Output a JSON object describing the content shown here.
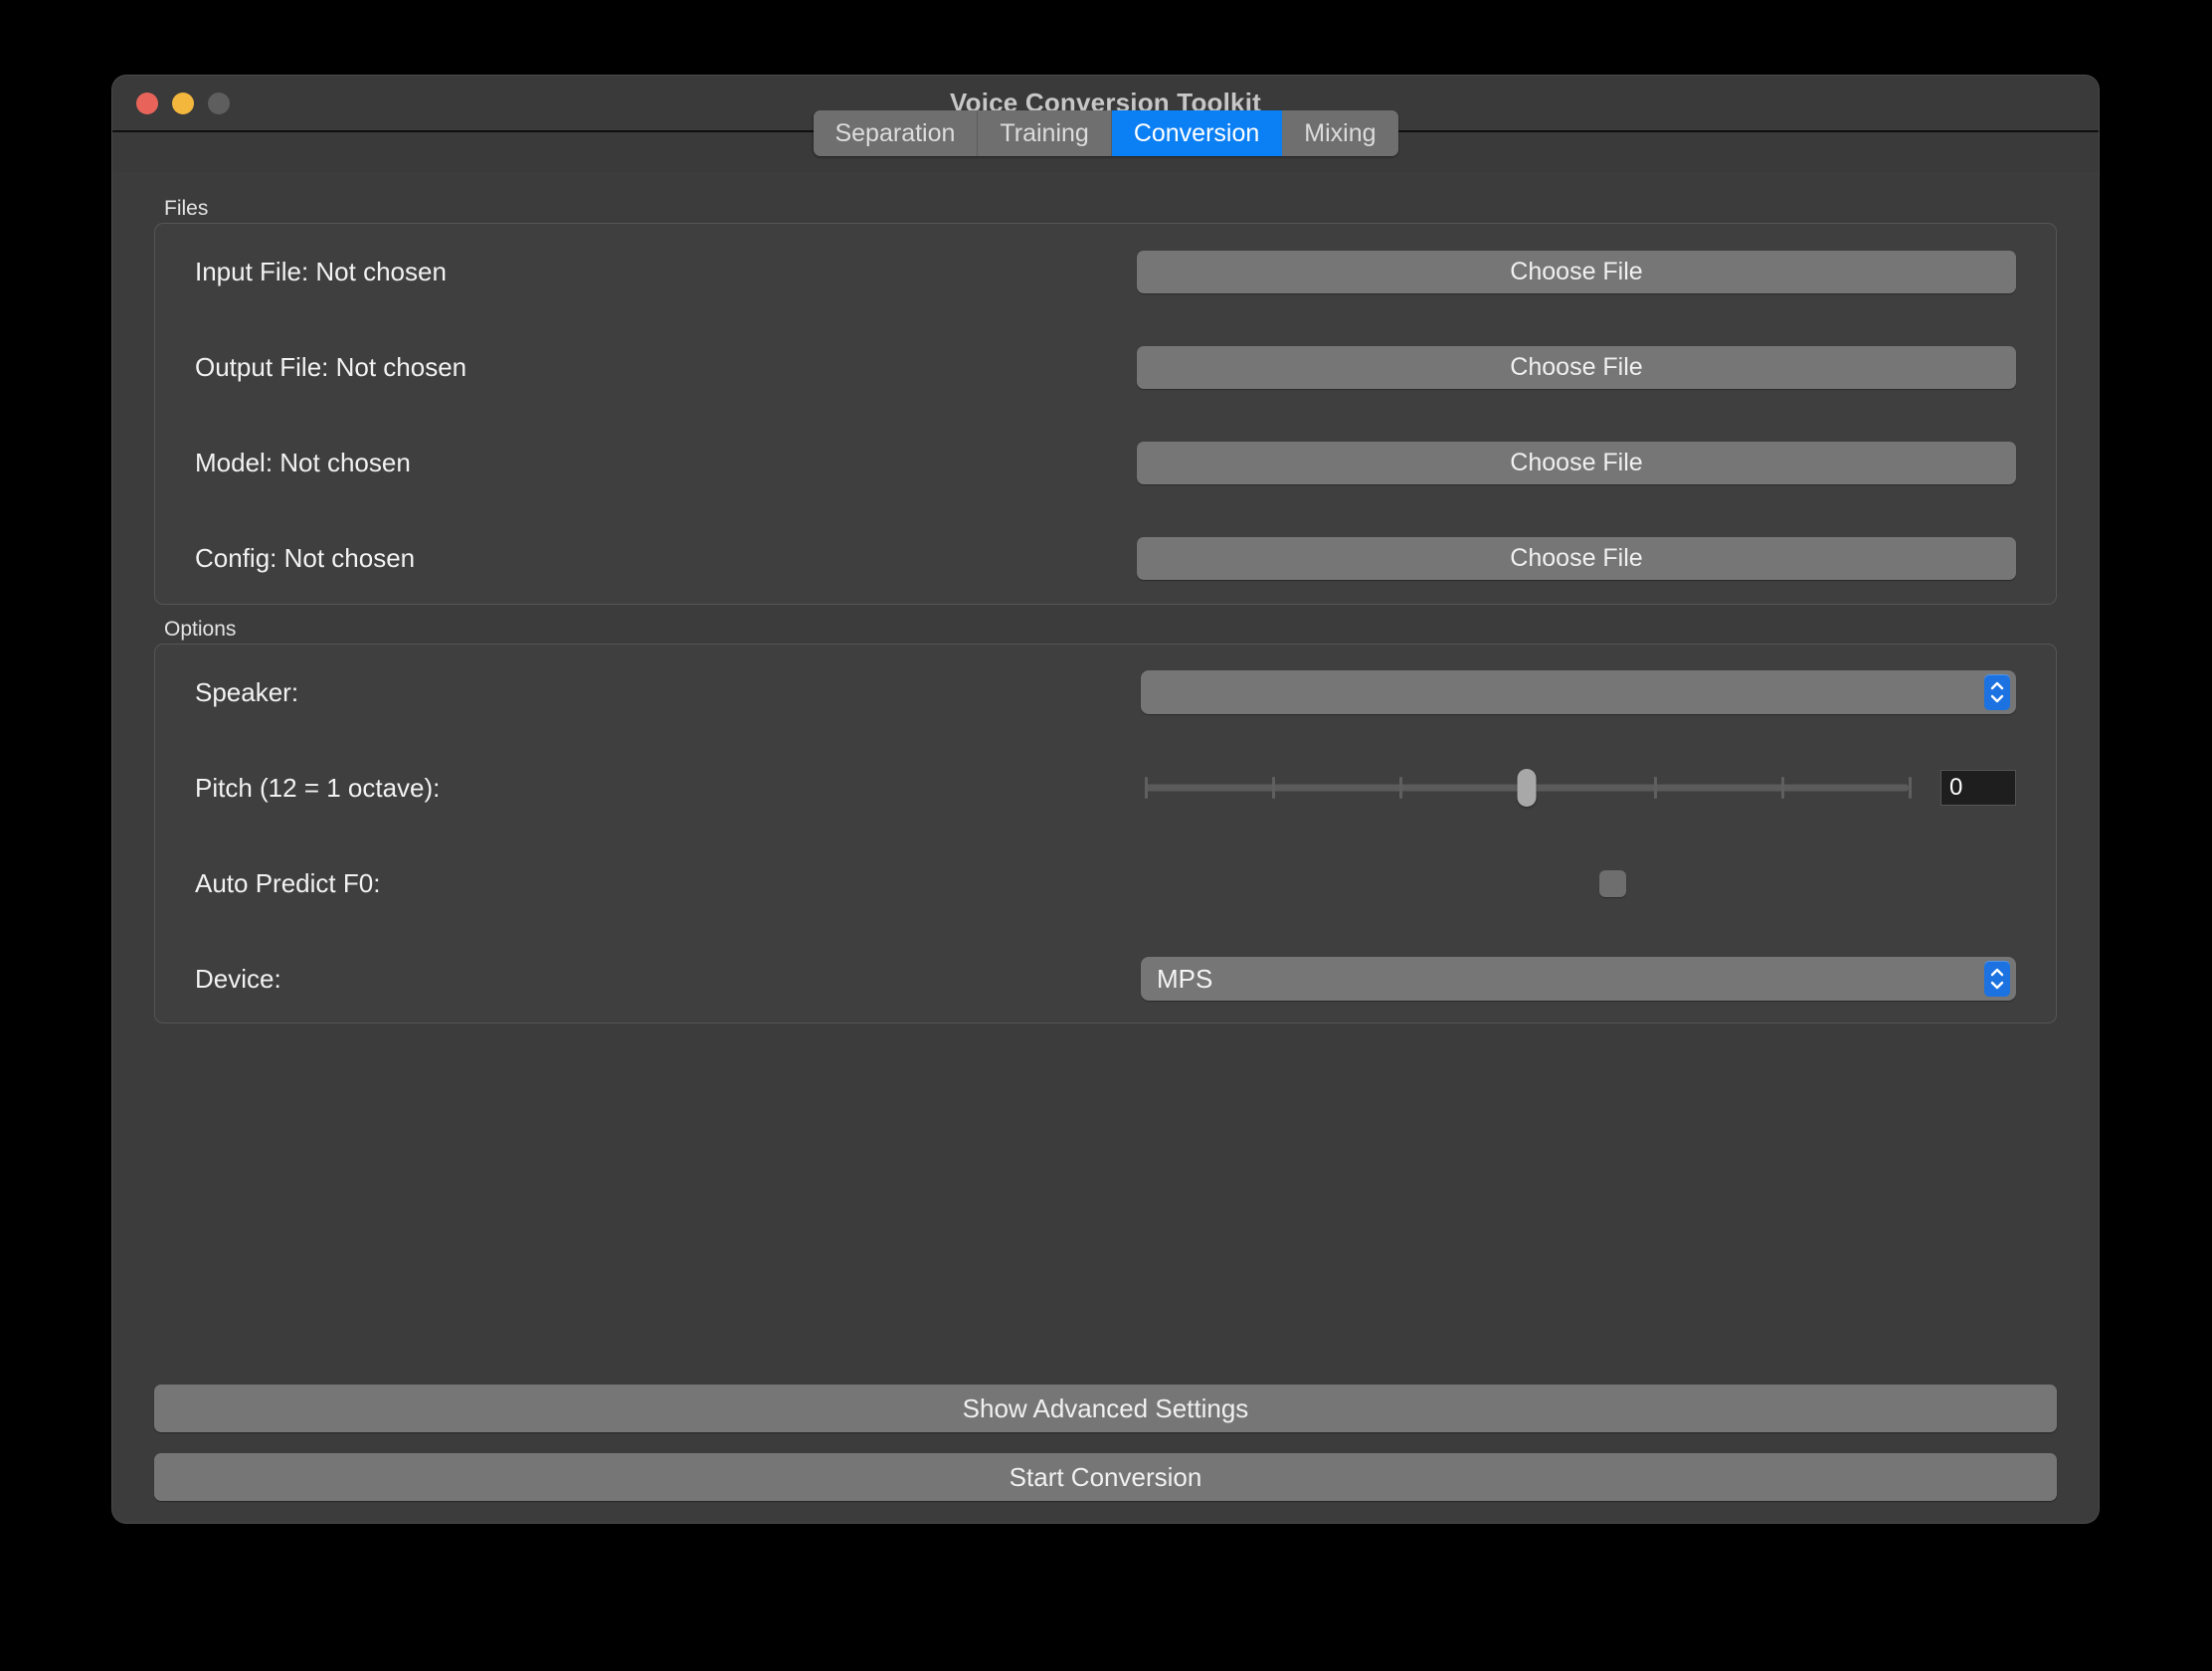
{
  "window": {
    "title": "Voice Conversion Toolkit",
    "traffic_lights": [
      "close",
      "minimize",
      "zoom"
    ]
  },
  "tabs": [
    {
      "label": "Separation",
      "active": false
    },
    {
      "label": "Training",
      "active": false
    },
    {
      "label": "Conversion",
      "active": true
    },
    {
      "label": "Mixing",
      "active": false
    }
  ],
  "files": {
    "group_label": "Files",
    "rows": [
      {
        "label": "Input File: Not chosen",
        "button": "Choose File"
      },
      {
        "label": "Output File: Not chosen",
        "button": "Choose File"
      },
      {
        "label": "Model: Not chosen",
        "button": "Choose File"
      },
      {
        "label": "Config: Not chosen",
        "button": "Choose File"
      }
    ]
  },
  "options": {
    "group_label": "Options",
    "speaker": {
      "label": "Speaker:",
      "value": "",
      "stepper_icon": "chevron-up-down-icon"
    },
    "pitch": {
      "label": "Pitch (12 = 1 octave):",
      "value": "0",
      "slider_position_percent": 50,
      "tick_count": 7
    },
    "auto_predict_f0": {
      "label": "Auto Predict F0:",
      "checked": false
    },
    "device": {
      "label": "Device:",
      "value": "MPS",
      "stepper_icon": "chevron-up-down-icon"
    }
  },
  "actions": {
    "advanced": "Show Advanced Settings",
    "start": "Start Conversion"
  },
  "colors": {
    "accent_blue": "#0b7ff4",
    "stepper_blue": "#1b72e0",
    "window_bg": "#3c3c3c",
    "control_gray": "#767676",
    "close_red": "#e8645a",
    "minimize_yellow": "#f2b73c",
    "zoom_gray": "#5e5e5e"
  }
}
